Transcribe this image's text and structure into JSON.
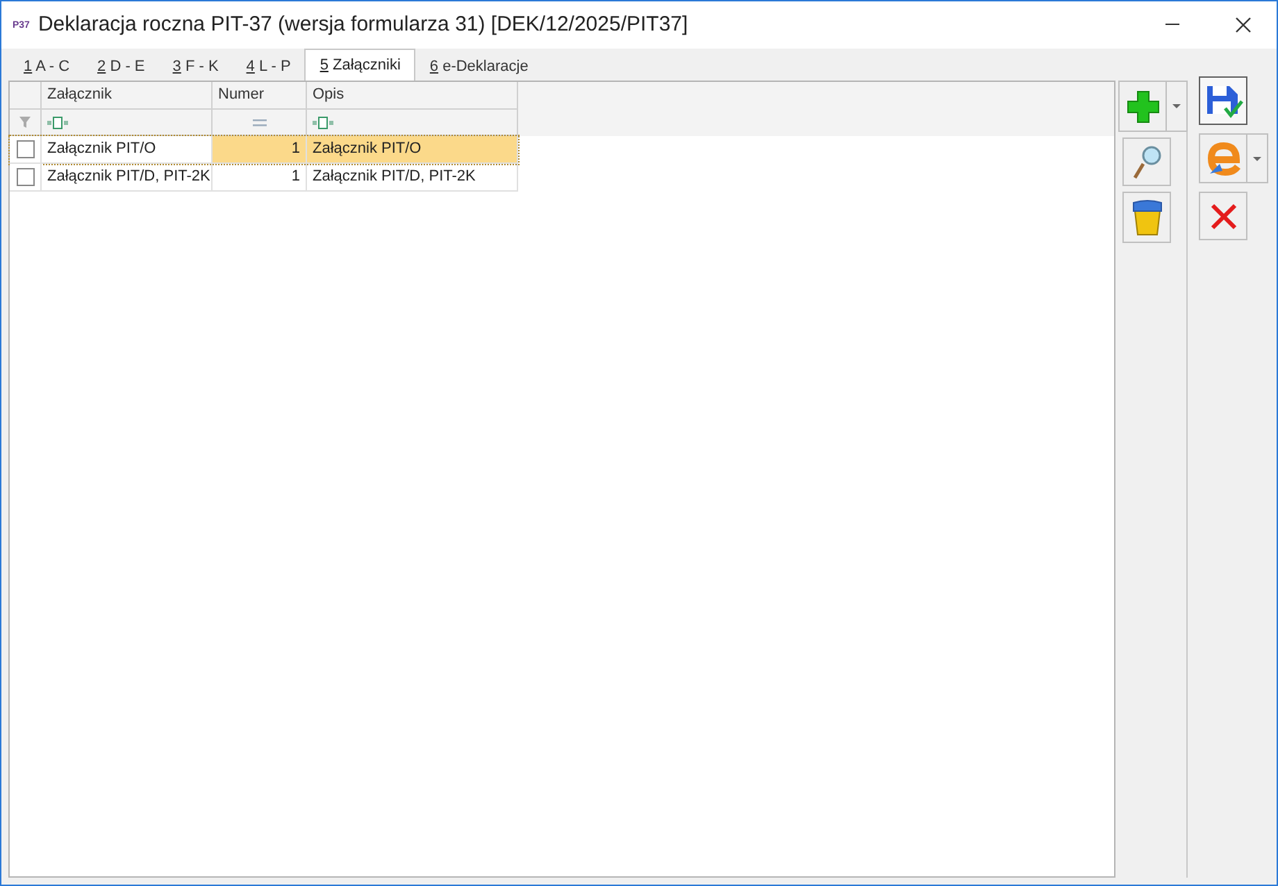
{
  "window": {
    "title": "Deklaracja roczna PIT-37 (wersja formularza 31) [DEK/12/2025/PIT37]",
    "icon_text": "P37"
  },
  "tabs": [
    {
      "key": "1",
      "label": " A - C",
      "selected": false
    },
    {
      "key": "2",
      "label": " D - E",
      "selected": false
    },
    {
      "key": "3",
      "label": " F - K",
      "selected": false
    },
    {
      "key": "4",
      "label": " L - P",
      "selected": false
    },
    {
      "key": "5",
      "label": " Załączniki",
      "selected": true
    },
    {
      "key": "6",
      "label": " e-Deklaracje",
      "selected": false
    }
  ],
  "table": {
    "columns": [
      {
        "label": "Załącznik",
        "kind": "text"
      },
      {
        "label": "Numer",
        "kind": "number"
      },
      {
        "label": "Opis",
        "kind": "text"
      }
    ],
    "rows": [
      {
        "checked": false,
        "selected": true,
        "cells": [
          "Załącznik PIT/O",
          "1",
          "Załącznik PIT/O"
        ]
      },
      {
        "checked": false,
        "selected": false,
        "cells": [
          "Załącznik PIT/D, PIT-2K",
          "1",
          "Załącznik PIT/D, PIT-2K"
        ]
      }
    ]
  }
}
